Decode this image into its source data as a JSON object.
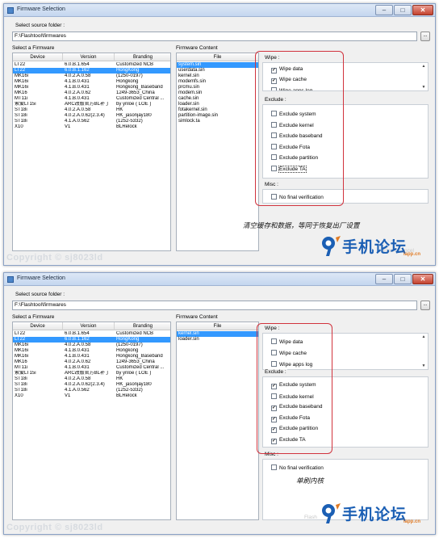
{
  "window": {
    "title": "Firmware Selection",
    "min_glyph": "–",
    "max_glyph": "□",
    "close_glyph": "✕"
  },
  "source_label": "Select source folder :",
  "source_path": "F:\\Flashtool\\firmwares",
  "browse_label": "...",
  "firmware_section_label": "Select a Firmware",
  "content_section_label": "Firmware Content",
  "columns": {
    "device": "Device",
    "version": "Version",
    "branding": "Branding",
    "file": "File"
  },
  "firmware_rows": [
    {
      "device": "LT22",
      "version": "6.0.B.1.654",
      "branding": "Customized NCB"
    },
    {
      "device": "LT22",
      "version": "6.0.B.1.162",
      "branding": "HongKong"
    },
    {
      "device": "MK16i",
      "version": "4.0.2.A.0.58",
      "branding": "(1250-0197)"
    },
    {
      "device": "MK16i",
      "version": "4.1.B.0.431",
      "branding": "Hongkong"
    },
    {
      "device": "MK16i",
      "version": "4.1.B.0.431",
      "branding": "Hongkong_Baseband"
    },
    {
      "device": "MK16",
      "version": "4.0.2.A.0.62",
      "branding": "1249-3653_China"
    },
    {
      "device": "MT11i",
      "version": "4.1.B.0.431",
      "branding": "Customized Central ..."
    },
    {
      "device": "索爱LT15i",
      "version": "ARC改版官方BL补丁",
      "branding": "by ynloe ( LOE )"
    },
    {
      "device": "ST18i",
      "version": "4.0.2.A.0.58",
      "branding": "HK"
    },
    {
      "device": "ST18i",
      "version": "4.0.2.A.0.62(2.3.4)",
      "branding": "HK_jasonjay180"
    },
    {
      "device": "ST18i",
      "version": "4.1.A.0.562",
      "branding": "(1252-5332)"
    },
    {
      "device": "X10",
      "version": "V1",
      "branding": "BLRelock"
    }
  ],
  "panels": [
    {
      "selected_row": 1,
      "files": [
        "system.sin",
        "userdata.sin",
        "kernel.sin",
        "modemfs.sin",
        "prcmu.sin",
        "modem.sin",
        "cache.sin",
        "loader.sin",
        "fotakernel.sin",
        "partition-image.sin",
        "simlock.ta"
      ],
      "wipe_title": "Wipe :",
      "wipe": [
        {
          "label": "Wipe data",
          "checked": true
        },
        {
          "label": "Wipe cache",
          "checked": true
        },
        {
          "label": "Wipe apps log",
          "checked": false
        }
      ],
      "exclude_title": "Exclude :",
      "exclude": [
        {
          "label": "Exclude system",
          "checked": false
        },
        {
          "label": "Exclude kernel",
          "checked": false
        },
        {
          "label": "Exclude baseband",
          "checked": false
        },
        {
          "label": "Exclude Fota",
          "checked": false
        },
        {
          "label": "Exclude partition",
          "checked": false
        },
        {
          "label": "Exclude TA",
          "checked": false
        }
      ],
      "misc_title": "Misc :",
      "misc": [
        {
          "label": "No final verification",
          "checked": false
        }
      ],
      "annotation": "清空缓存和数据，等同于恢复出厂设置",
      "watermark": "Copyright © sj8023ld",
      "faint_button": "Flash  Cancel",
      "logo_text": "手机论坛",
      "logo_sub": "iapp.cn",
      "check_mark": "✓"
    },
    {
      "selected_row": 1,
      "files": [
        "kernel.sin",
        "loader.sin"
      ],
      "wipe_title": "Wipe :",
      "wipe": [
        {
          "label": "Wipe data",
          "checked": false
        },
        {
          "label": "Wipe cache",
          "checked": false
        },
        {
          "label": "Wipe apps log",
          "checked": false
        }
      ],
      "exclude_title": "Exclude :",
      "exclude": [
        {
          "label": "Exclude system",
          "checked": true
        },
        {
          "label": "Exclude kernel",
          "checked": false
        },
        {
          "label": "Exclude baseband",
          "checked": true
        },
        {
          "label": "Exclude Fota",
          "checked": true
        },
        {
          "label": "Exclude partition",
          "checked": true
        },
        {
          "label": "Exclude TA",
          "checked": true
        }
      ],
      "misc_title": "Misc :",
      "misc": [
        {
          "label": "No final verification",
          "checked": false
        }
      ],
      "annotation": "单刷内核",
      "watermark": "Copyright © sj8023ld",
      "faint_button": "Flash",
      "logo_text": "手机论坛",
      "logo_sub": "iapp.cn",
      "check_mark": "✓"
    }
  ]
}
